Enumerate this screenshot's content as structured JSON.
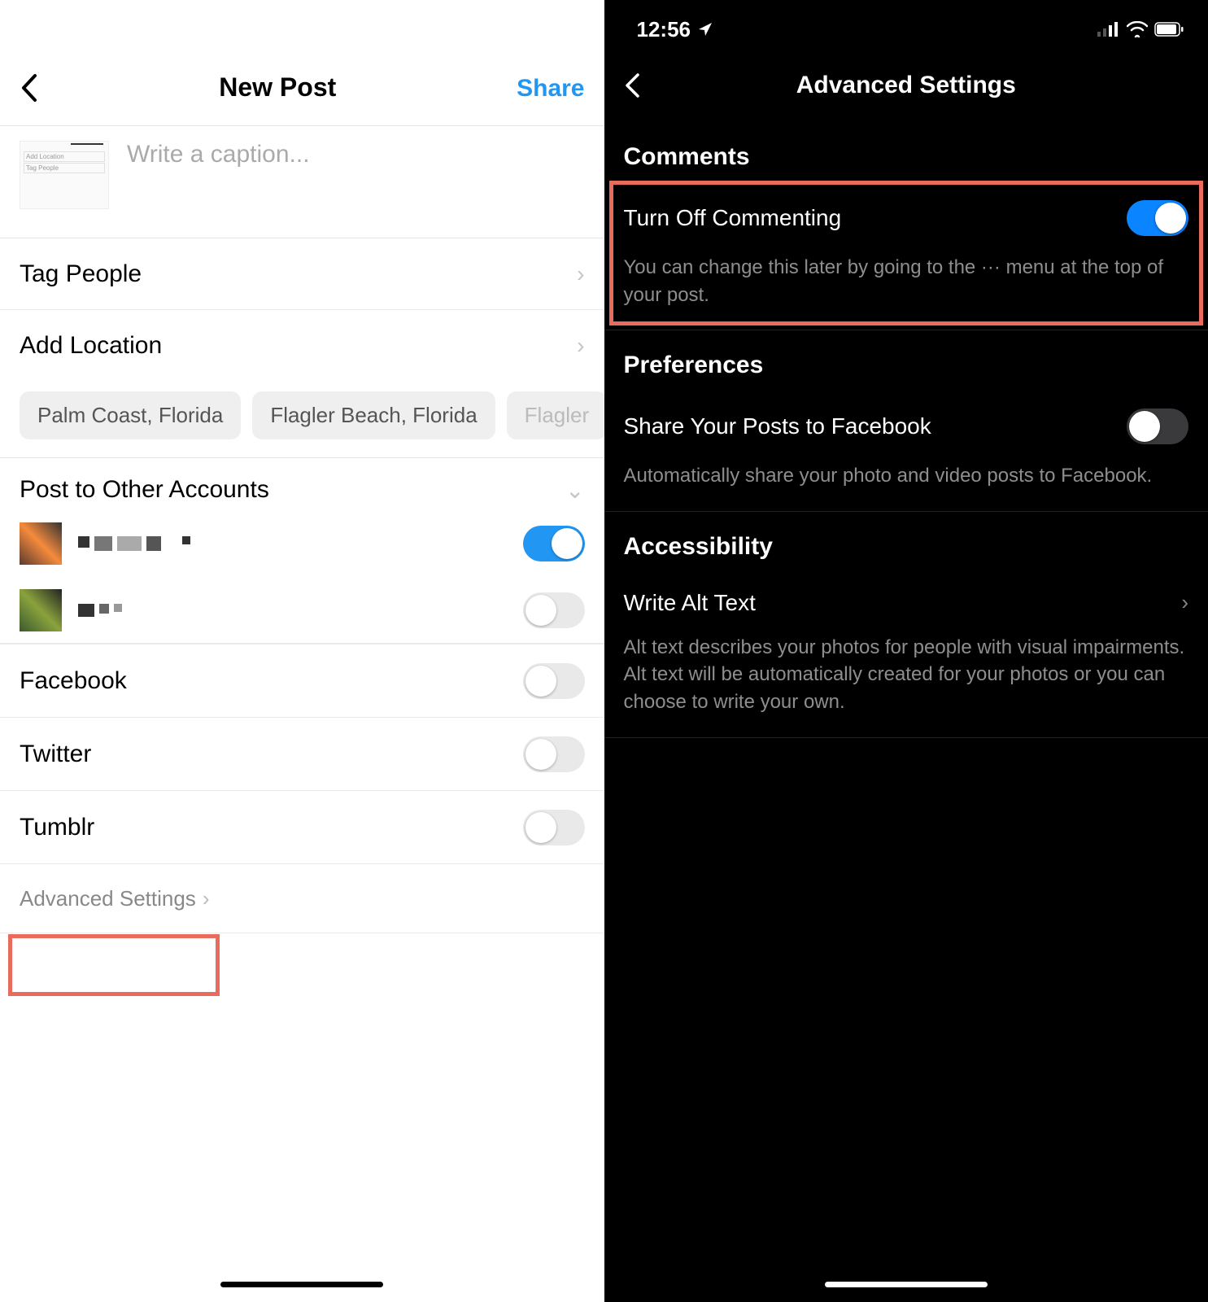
{
  "left": {
    "header": {
      "title": "New Post",
      "share": "Share"
    },
    "caption_placeholder": "Write a caption...",
    "thumb_lines": [
      "Add Location",
      "Tag People"
    ],
    "tag_people": "Tag People",
    "add_location": "Add Location",
    "location_chips": [
      "Palm Coast, Florida",
      "Flagler Beach, Florida",
      "Flagler"
    ],
    "post_other": "Post to Other Accounts",
    "share_targets": {
      "facebook": "Facebook",
      "twitter": "Twitter",
      "tumblr": "Tumblr"
    },
    "advanced": "Advanced Settings"
  },
  "right": {
    "status_time": "12:56",
    "header_title": "Advanced Settings",
    "sections": {
      "comments": {
        "title": "Comments",
        "toggle_label": "Turn Off Commenting",
        "desc": "You can change this later by going to the ··· menu at the top of your post."
      },
      "preferences": {
        "title": "Preferences",
        "toggle_label": "Share Your Posts to Facebook",
        "desc": "Automatically share your photo and video posts to Facebook."
      },
      "accessibility": {
        "title": "Accessibility",
        "item_label": "Write Alt Text",
        "desc": "Alt text describes your photos for people with visual impairments. Alt text will be automatically created for your photos or you can choose to write your own."
      }
    }
  }
}
